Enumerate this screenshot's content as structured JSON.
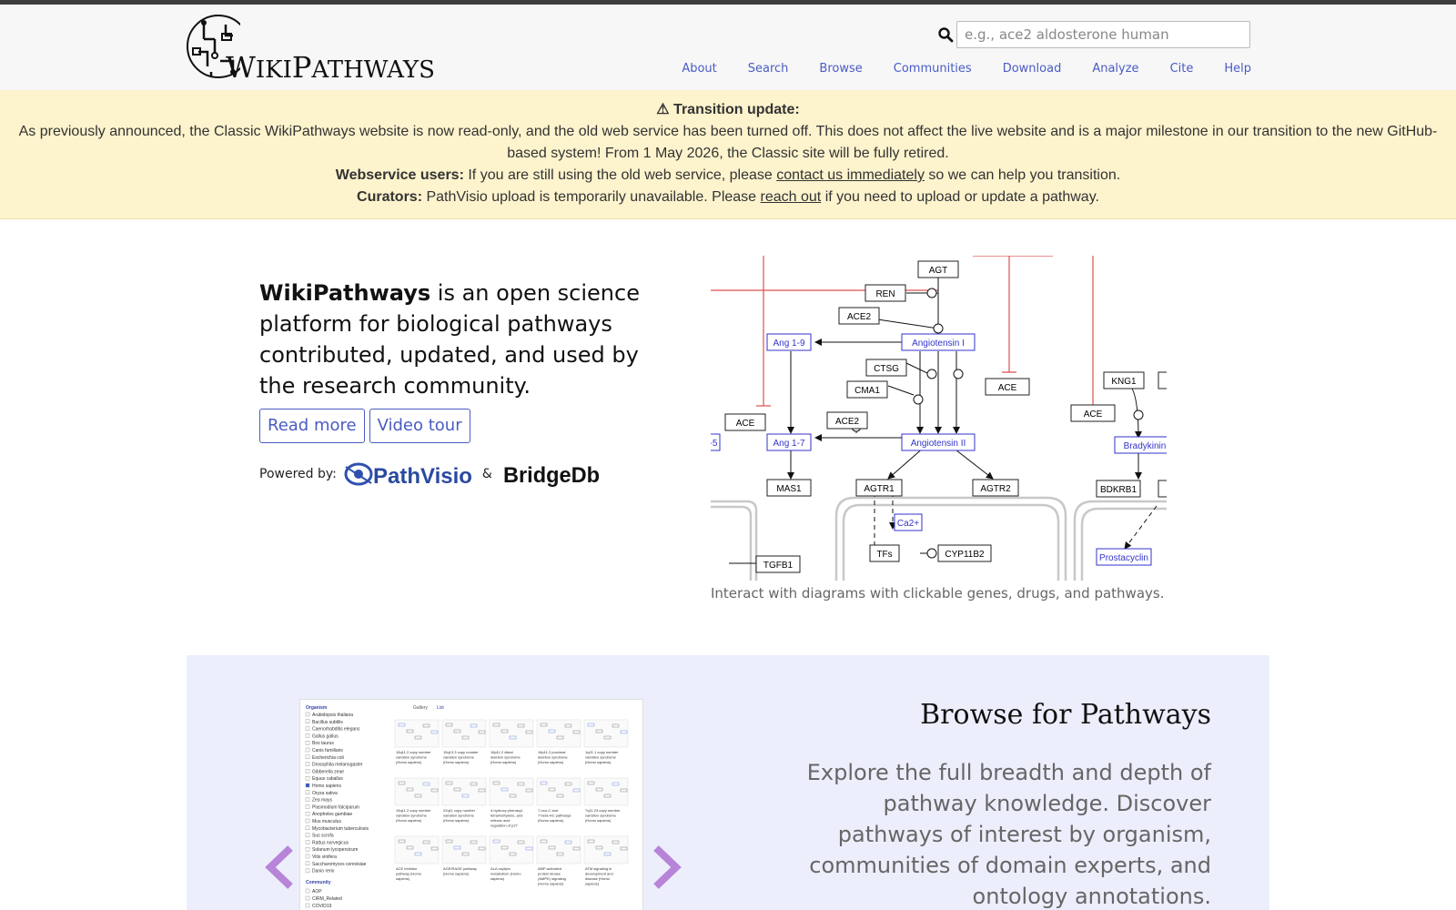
{
  "header": {
    "logo_text_a": "W",
    "logo_text_b": "IKI",
    "logo_text_c": "P",
    "logo_text_d": "ATHWAYS",
    "search_placeholder": "e.g., ace2 aldosterone human",
    "nav": [
      "About",
      "Search",
      "Browse",
      "Communities",
      "Download",
      "Analyze",
      "Cite",
      "Help"
    ]
  },
  "banner": {
    "title": "⚠ Transition update:",
    "line1": "As previously announced, the Classic WikiPathways website is now read-only, and the old web service has been turned off. This does not affect the live website and is a major milestone in our transition to the new GitHub-based system! From 1 May 2026, the Classic site will be fully retired.",
    "webservice_label": "Webservice users:",
    "webservice_text_a": "If you are still using the old web service, please",
    "webservice_link": "contact us immediately",
    "webservice_text_b": "so we can help you transition.",
    "curators_label": "Curators:",
    "curators_text_a": "PathVisio upload is temporarily unavailable. Please",
    "curators_link": "reach out",
    "curators_text_b": "if you need to upload or update a pathway."
  },
  "hero": {
    "brand": "WikiPathways",
    "tagline": " is an open science platform for biological pathways contributed, updated, and used by the research community.",
    "read_more": "Read more",
    "video_tour": "Video tour",
    "powered_by": "Powered by:",
    "pathvisio": "PathVisio",
    "amp": "&",
    "bridgedb": "BridgeDb"
  },
  "diagram": {
    "caption": "Interact with diagrams with clickable genes, drugs, and pathways.",
    "nodes": [
      "AGT",
      "REN",
      "ACE2",
      "Ang 1-9",
      "Angiotensin I",
      "CTSG",
      "CMA1",
      "ACE",
      "ACE",
      "ACE2",
      "Ang 1-7",
      "Angiotensin II",
      "MAS1",
      "AGTR1",
      "AGTR2",
      "Ca2+",
      "TFs",
      "CYP11B2",
      "TGFB1",
      "KNG1",
      "ACE",
      "Bradykinin",
      "BDKRB1",
      "Prostacyclin",
      "-5"
    ],
    "colors": {
      "gene_border": "#222222",
      "metabolite": "#3333cc",
      "inhibition": "#e05050"
    }
  },
  "browse": {
    "title": "Browse for Pathways",
    "description": "Explore the full breadth and depth of pathway knowledge. Discover pathways of interest by organism, communities of domain experts, and ontology annotations.",
    "shot": {
      "organism_header": "Organism",
      "tabs": [
        "Gallery",
        "List"
      ],
      "organisms": [
        "Arabidopsis thaliana",
        "Bacillus subtilis",
        "Caenorhabditis elegans",
        "Gallus gallus",
        "Bos taurus",
        "Canis familiaris",
        "Escherichia coli",
        "Drosophila melanogaster",
        "Gibberella zeae",
        "Equus caballus",
        "Homo sapiens",
        "Oryza sativa",
        "Zea mays",
        "Plasmodium falciparum",
        "Anopheles gambiae",
        "Mus musculus",
        "Mycobacterium tuberculosis",
        "Sus scrofa",
        "Rattus norvegicus",
        "Solanum lycopersicum",
        "Vitis vinifera",
        "Saccharomyces cerevisiae",
        "Danio rerio"
      ],
      "community_header": "Community",
      "communities": [
        "AOP",
        "CIRM_Related",
        "COVID19"
      ],
      "cards": [
        "15q11.2 copy number variation syndrome (Homo sapiens)",
        "15q13.3 copy number variation syndrome (Homo sapiens)",
        "16p11.2 distal deletion syndrome (Homo sapiens)",
        "16p11.2 proximal deletion syndrome (Homo sapiens)",
        "1q21.1 copy number variation syndrome (Homo sapiens)",
        "15q11.2 copy number variation syndrome (Homo sapiens)",
        "22q11 copy number variation syndrome (Homo sapiens)",
        "4-hydroxy phenacyl, tetramethylene, and retinoic acid regulation of p27 expression (Homo sapiens)",
        "7-oxo-C and 7-beta-HC pathways (Homo sapiens)",
        "7q11.23 copy number variation syndrome (Homo sapiens)",
        "ACE inhibitor pathway (Homo sapiens)",
        "AGE/RAGE pathway (Homo sapiens)",
        "ALA oxylipin metabolism (Homo sapiens)",
        "AMP-activated protein kinase (AMPK) signaling (Homo sapiens)",
        "ATM signaling in development and disease (Homo sapiens)"
      ]
    }
  }
}
